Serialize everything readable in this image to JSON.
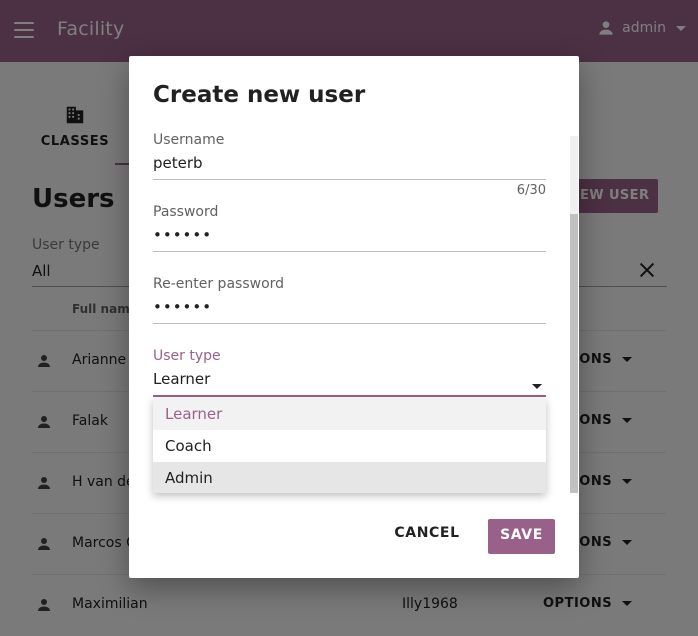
{
  "colors": {
    "brand": "#996189",
    "scrim": "rgba(0,0,0,0.5)",
    "text": "#212121",
    "muted": "#616161"
  },
  "appbar": {
    "menu_icon": "hamburger-menu-icon",
    "title": "Facility",
    "account_icon": "person-icon",
    "account_label": "admin"
  },
  "nav": {
    "tab_icon": "building-icon",
    "tab_label": "CLASSES"
  },
  "page": {
    "heading": "Users",
    "new_user_button": "EW USER",
    "filter_label": "User type",
    "filter_value": "All",
    "clear_icon": "close-icon",
    "column_full_name": "Full nam"
  },
  "rows": [
    {
      "name": "Arianne",
      "username": "",
      "options": "OPTIONS"
    },
    {
      "name": "Falak",
      "username": "",
      "options": "OPTIONS"
    },
    {
      "name": "H van de",
      "username": "",
      "options": "OPTIONS"
    },
    {
      "name": "Marcos C",
      "username": "",
      "options": "OPTIONS"
    },
    {
      "name": "Maximilian",
      "username": "Illy1968",
      "options": "OPTIONS"
    }
  ],
  "modal": {
    "title": "Create new user",
    "username": {
      "label": "Username",
      "value": "peterb",
      "counter": "6/30"
    },
    "password": {
      "label": "Password",
      "value": "••••••"
    },
    "reenter": {
      "label": "Re-enter password",
      "value": "••••••"
    },
    "user_type": {
      "label": "User type",
      "value": "Learner",
      "options": [
        "Learner",
        "Coach",
        "Admin"
      ]
    },
    "cancel": "CANCEL",
    "save": "SAVE"
  }
}
